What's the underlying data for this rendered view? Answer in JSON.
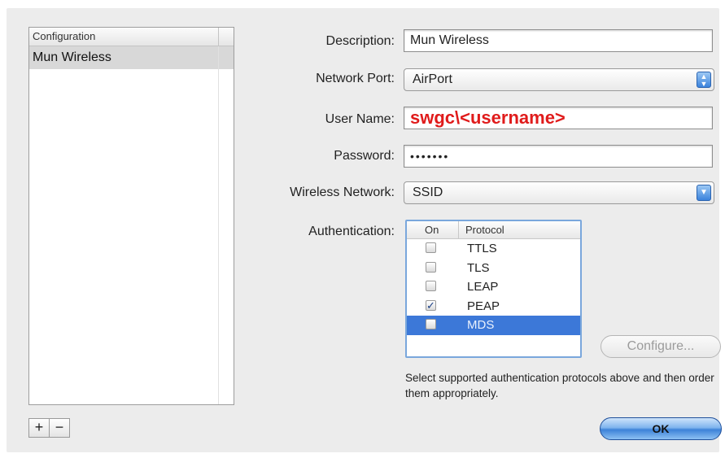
{
  "config_list": {
    "header": "Configuration",
    "items": [
      "Mun Wireless"
    ],
    "add_label": "+",
    "remove_label": "−"
  },
  "form": {
    "description_label": "Description:",
    "description_value": "Mun Wireless",
    "network_port_label": "Network Port:",
    "network_port_value": "AirPort",
    "username_label": "User Name:",
    "username_value": "swgc\\<username>",
    "password_label": "Password:",
    "password_value": "•••••••",
    "wireless_network_label": "Wireless Network:",
    "wireless_network_value": "SSID",
    "authentication_label": "Authentication:"
  },
  "auth_table": {
    "col_on": "On",
    "col_protocol": "Protocol",
    "rows": [
      {
        "protocol": "TTLS",
        "checked": false,
        "selected": false
      },
      {
        "protocol": "TLS",
        "checked": false,
        "selected": false
      },
      {
        "protocol": "LEAP",
        "checked": false,
        "selected": false
      },
      {
        "protocol": "PEAP",
        "checked": true,
        "selected": false
      },
      {
        "protocol": "MDS",
        "checked": false,
        "selected": true
      }
    ],
    "check_mark": "✓"
  },
  "configure_button": "Configure...",
  "hint_text": "Select supported authentication protocols above and then order them appropriately.",
  "ok_button": "OK",
  "colors": {
    "username_highlight": "#e01b1b",
    "selection": "#3c78d8",
    "panel_bg": "#ececec"
  }
}
